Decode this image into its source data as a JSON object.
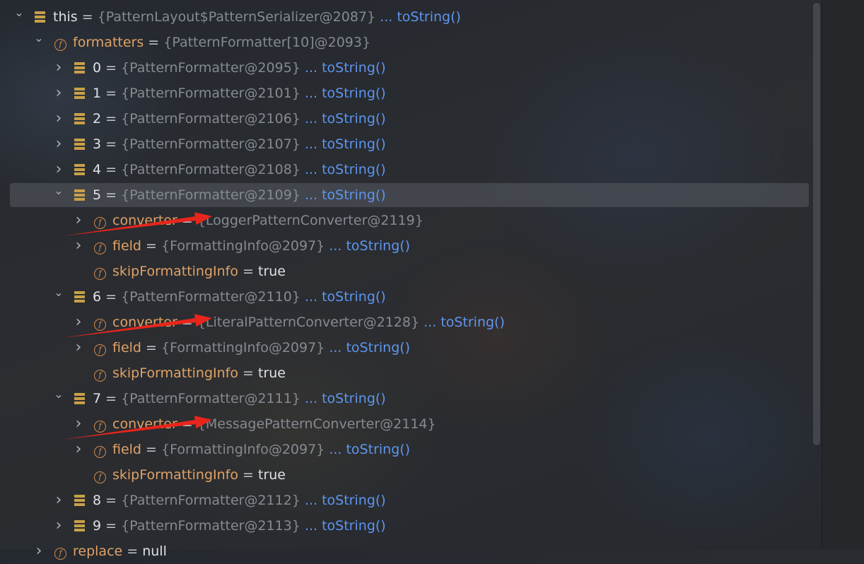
{
  "tree": {
    "rows": [
      {
        "depth": 0,
        "expanded": true,
        "icon": "array",
        "name": "this",
        "value": "{PatternLayout$PatternSerializer@2087}",
        "link": "... toString()"
      },
      {
        "depth": 1,
        "expanded": true,
        "icon": "field",
        "name": "formatters",
        "value": "{PatternFormatter[10]@2093}",
        "link": ""
      },
      {
        "depth": 2,
        "expanded": false,
        "icon": "array",
        "name": "0",
        "value": "{PatternFormatter@2095}",
        "link": "... toString()"
      },
      {
        "depth": 2,
        "expanded": false,
        "icon": "array",
        "name": "1",
        "value": "{PatternFormatter@2101}",
        "link": "... toString()"
      },
      {
        "depth": 2,
        "expanded": false,
        "icon": "array",
        "name": "2",
        "value": "{PatternFormatter@2106}",
        "link": "... toString()"
      },
      {
        "depth": 2,
        "expanded": false,
        "icon": "array",
        "name": "3",
        "value": "{PatternFormatter@2107}",
        "link": "... toString()"
      },
      {
        "depth": 2,
        "expanded": false,
        "icon": "array",
        "name": "4",
        "value": "{PatternFormatter@2108}",
        "link": "... toString()"
      },
      {
        "depth": 2,
        "expanded": true,
        "icon": "array",
        "name": "5",
        "value": "{PatternFormatter@2109}",
        "link": "... toString()",
        "selected": true
      },
      {
        "depth": 3,
        "expanded": false,
        "icon": "field",
        "name": "converter",
        "value": "{LoggerPatternConverter@2119}",
        "link": ""
      },
      {
        "depth": 3,
        "expanded": false,
        "icon": "field",
        "name": "field",
        "value": "{FormattingInfo@2097}",
        "link": "... toString()"
      },
      {
        "depth": 3,
        "leaf": true,
        "icon": "field",
        "name": "skipFormattingInfo",
        "plain": "true"
      },
      {
        "depth": 2,
        "expanded": true,
        "icon": "array",
        "name": "6",
        "value": "{PatternFormatter@2110}",
        "link": "... toString()"
      },
      {
        "depth": 3,
        "expanded": false,
        "icon": "field",
        "name": "converter",
        "value": "{LiteralPatternConverter@2128}",
        "link": "... toString()"
      },
      {
        "depth": 3,
        "expanded": false,
        "icon": "field",
        "name": "field",
        "value": "{FormattingInfo@2097}",
        "link": "... toString()"
      },
      {
        "depth": 3,
        "leaf": true,
        "icon": "field",
        "name": "skipFormattingInfo",
        "plain": "true"
      },
      {
        "depth": 2,
        "expanded": true,
        "icon": "array",
        "name": "7",
        "value": "{PatternFormatter@2111}",
        "link": "... toString()"
      },
      {
        "depth": 3,
        "expanded": false,
        "icon": "field",
        "name": "converter",
        "value": "{MessagePatternConverter@2114}",
        "link": ""
      },
      {
        "depth": 3,
        "expanded": false,
        "icon": "field",
        "name": "field",
        "value": "{FormattingInfo@2097}",
        "link": "... toString()"
      },
      {
        "depth": 3,
        "leaf": true,
        "icon": "field",
        "name": "skipFormattingInfo",
        "plain": "true"
      },
      {
        "depth": 2,
        "expanded": false,
        "icon": "array",
        "name": "8",
        "value": "{PatternFormatter@2112}",
        "link": "... toString()"
      },
      {
        "depth": 2,
        "expanded": false,
        "icon": "array",
        "name": "9",
        "value": "{PatternFormatter@2113}",
        "link": "... toString()"
      },
      {
        "depth": 1,
        "expanded": false,
        "icon": "field",
        "name": "replace",
        "plain": "null",
        "partial": true
      }
    ]
  },
  "colors": {
    "link": "#5e95ee",
    "field_name": "#e0a266",
    "value": "#868a91",
    "annotation_arrow": "#e8251c"
  },
  "annotations": {
    "arrows": 3,
    "arrow_targets": [
      "converter",
      "converter",
      "converter"
    ]
  }
}
